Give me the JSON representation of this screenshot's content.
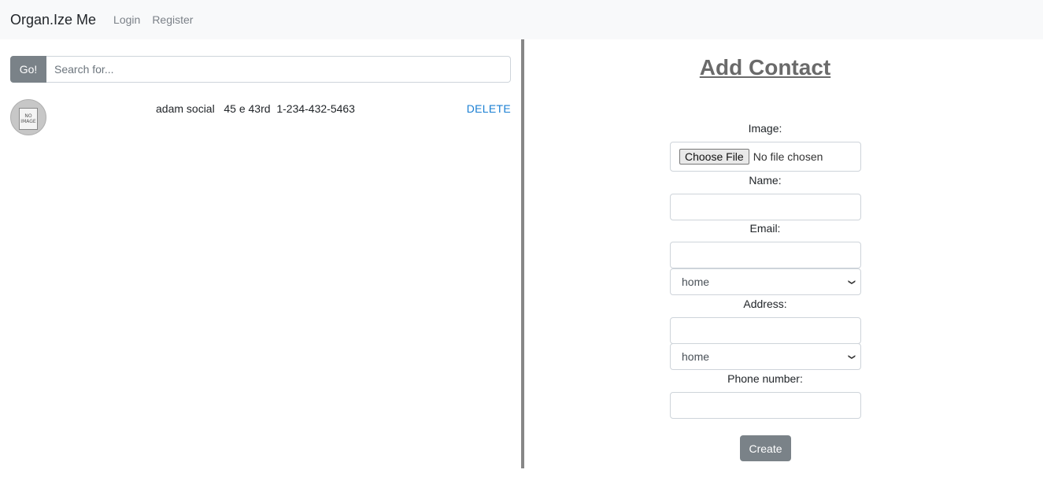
{
  "navbar": {
    "brand": "Organ.Ize Me",
    "links": [
      "Login",
      "Register"
    ]
  },
  "search": {
    "button_label": "Go!",
    "placeholder": "Search for..."
  },
  "contacts": [
    {
      "avatar_text": "NO IMAGE",
      "name": "adam social",
      "address": "45 e 43rd",
      "phone": "1-234-432-5463",
      "delete_label": "DELETE"
    }
  ],
  "form": {
    "title": "Add Contact",
    "image_label": "Image:",
    "file_button": "Choose File",
    "file_status": "No file chosen",
    "name_label": "Name:",
    "email_label": "Email:",
    "email_type": "home",
    "address_label": "Address:",
    "address_type": "home",
    "phone_label": "Phone number:",
    "submit_label": "Create"
  },
  "colors": {
    "navbar_bg": "#f8f9fa",
    "button_gray": "#7a8288",
    "link_blue": "#1a7fd3",
    "divider": "#878787"
  },
  "icons": [
    "no-image-avatar",
    "chevron-down-icon"
  ]
}
